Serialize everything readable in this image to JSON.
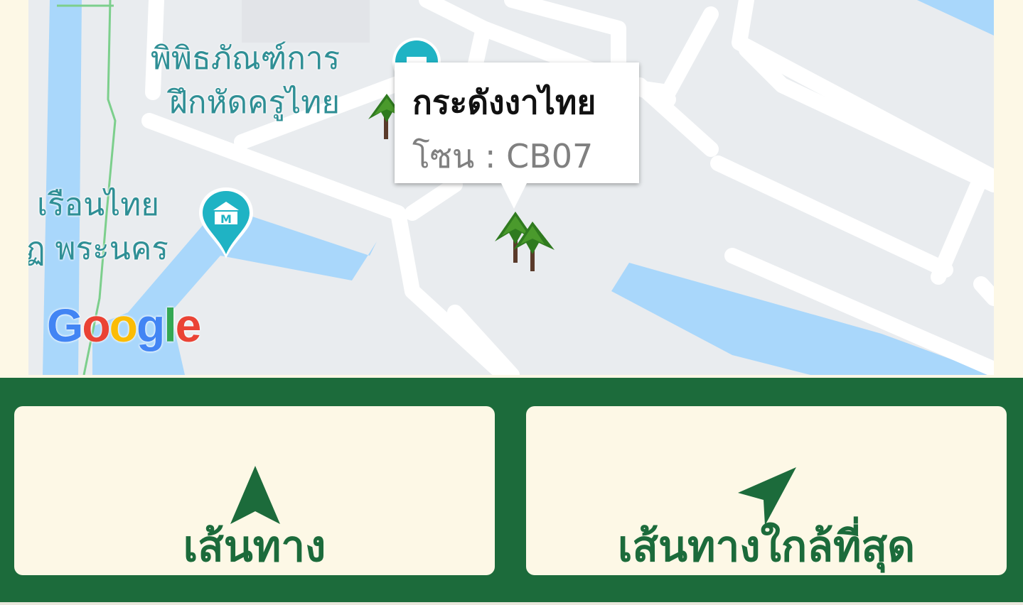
{
  "map": {
    "poi": [
      {
        "lines": [
          "พิพิธภัณฑ์การ",
          "ฝึกหัดครูไทย"
        ],
        "icon": "museum-pin-icon"
      },
      {
        "lines": [
          "เรือนไทย",
          "ฏ พระนคร"
        ],
        "icon": "museum-pin-icon"
      }
    ],
    "infowindow": {
      "title": "กระดังงาไทย",
      "zone": "โซน : CB07"
    },
    "attribution": {
      "letters": [
        "G",
        "o",
        "o",
        "g",
        "l",
        "e"
      ],
      "colors": [
        "#4285f4",
        "#ea4335",
        "#fbbc05",
        "#4285f4",
        "#34a853",
        "#ea4335"
      ]
    },
    "colors": {
      "land": "#e9ecef",
      "road": "#ffffff",
      "water": "#a9d7fb",
      "poi_text": "#2f8f95",
      "pin": "#1fb3c4"
    }
  },
  "actions": {
    "route_label": "เส้นทาง",
    "nearest_route_label": "เส้นทางใกล้ที่สุด"
  },
  "theme": {
    "primary": "#1c6b3b",
    "background": "#fdf8e6"
  }
}
